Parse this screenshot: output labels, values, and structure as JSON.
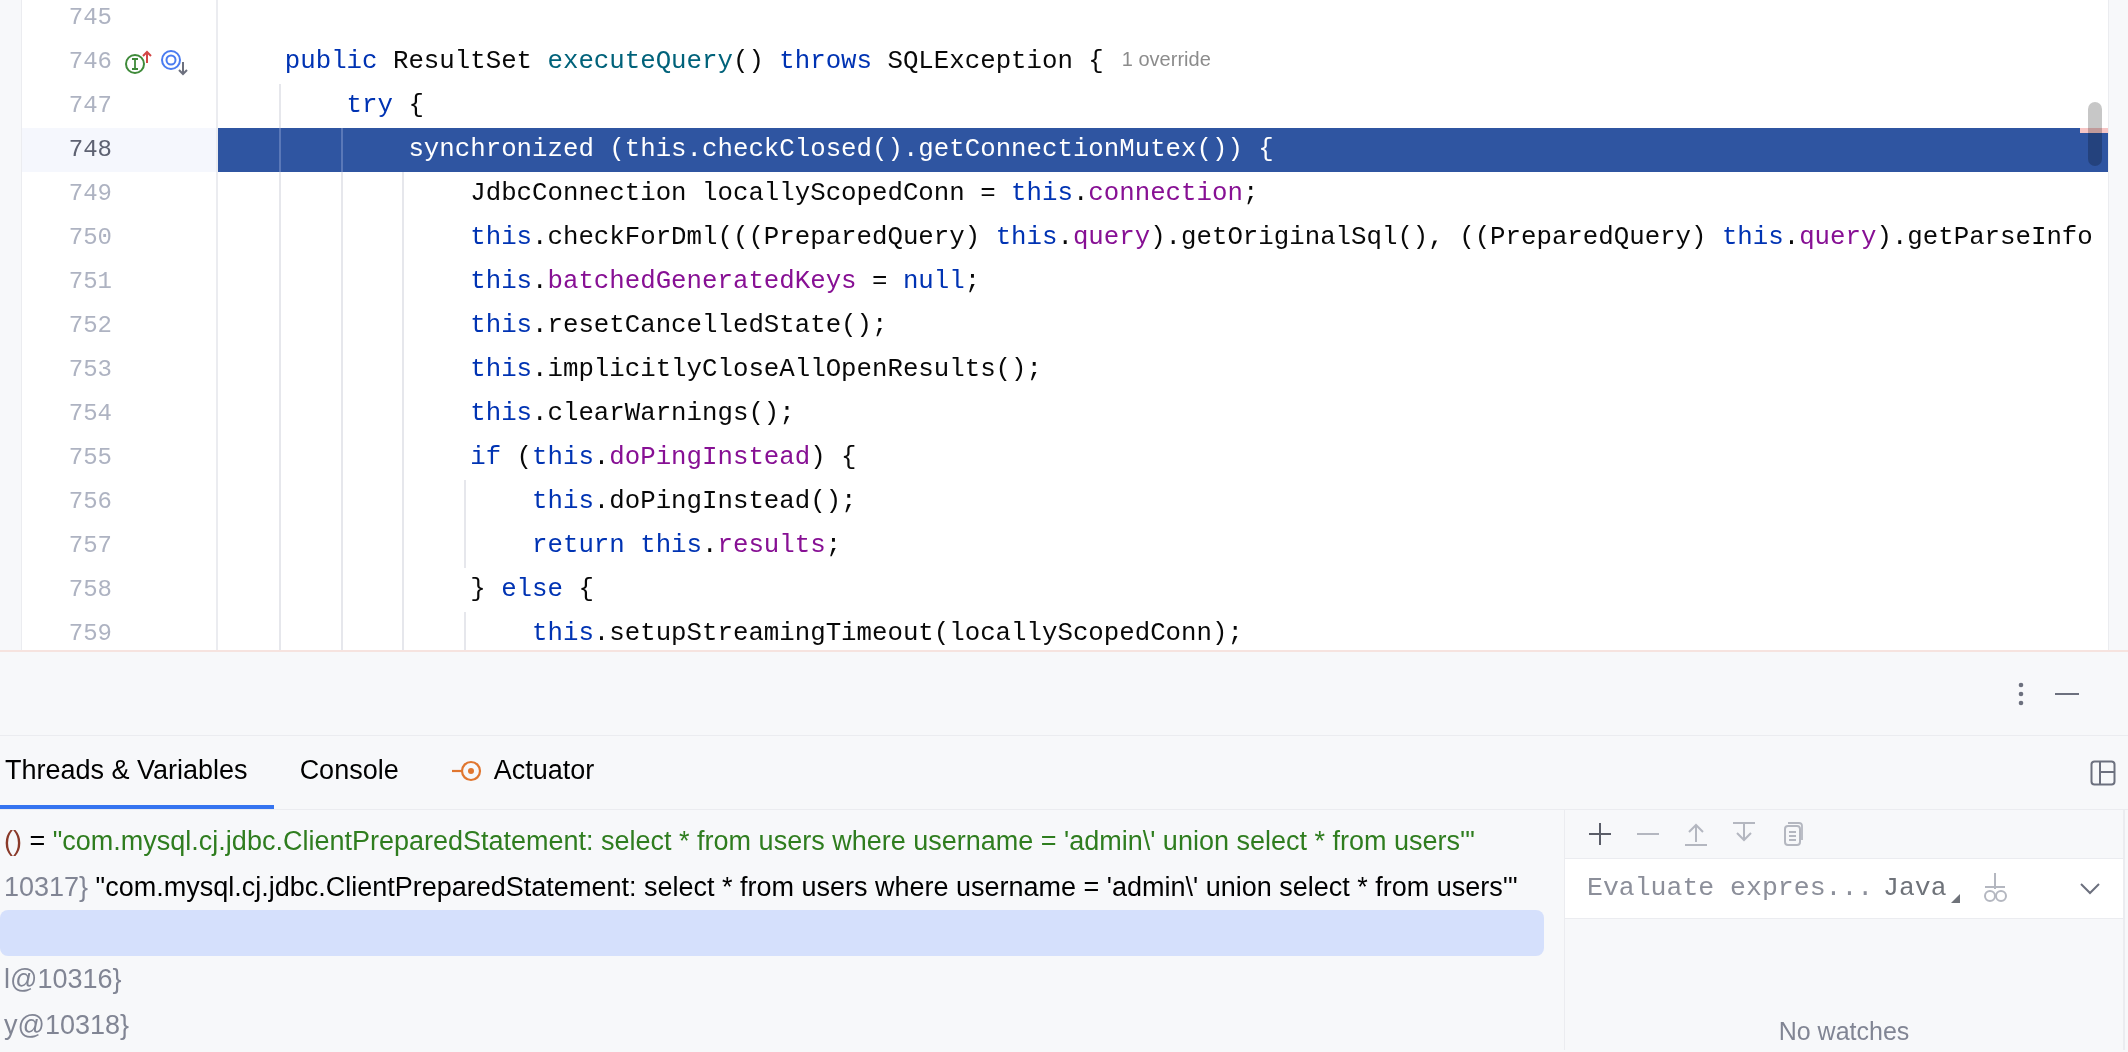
{
  "editor": {
    "lines": [
      {
        "number": "745",
        "current": false,
        "gutter_marks": false
      },
      {
        "number": "746",
        "current": false,
        "gutter_marks": true,
        "tokens": [
          {
            "t": "    public",
            "kind": "keyword"
          },
          {
            "t": " ResultSet ",
            "kind": "plain"
          },
          {
            "t": "executeQuery",
            "kind": "method"
          },
          {
            "t": "() ",
            "kind": "plain"
          },
          {
            "t": "throws",
            "kind": "keyword"
          },
          {
            "t": " SQLException {",
            "kind": "plain"
          }
        ],
        "hint": "1 override"
      },
      {
        "number": "747",
        "current": false,
        "gutter_marks": false,
        "tokens": [
          {
            "t": "        try",
            "kind": "keyword"
          },
          {
            "t": " {",
            "kind": "plain"
          }
        ]
      },
      {
        "number": "748",
        "current": true,
        "gutter_marks": false,
        "tokens": [
          {
            "t": "            synchronized",
            "kind": "keyword"
          },
          {
            "t": " (",
            "kind": "plain"
          },
          {
            "t": "this",
            "kind": "keyword"
          },
          {
            "t": ".checkClosed().getConnectionMutex()) {",
            "kind": "plain"
          }
        ]
      },
      {
        "number": "749",
        "current": false,
        "gutter_marks": false,
        "tokens": [
          {
            "t": "                JdbcConnection locallyScopedConn = ",
            "kind": "plain"
          },
          {
            "t": "this",
            "kind": "keyword"
          },
          {
            "t": ".",
            "kind": "plain"
          },
          {
            "t": "connection",
            "kind": "field"
          },
          {
            "t": ";",
            "kind": "plain"
          }
        ]
      },
      {
        "number": "750",
        "current": false,
        "gutter_marks": false,
        "tokens": [
          {
            "t": "                this",
            "kind": "keyword"
          },
          {
            "t": ".checkForDml(((PreparedQuery) ",
            "kind": "plain"
          },
          {
            "t": "this",
            "kind": "keyword"
          },
          {
            "t": ".",
            "kind": "plain"
          },
          {
            "t": "query",
            "kind": "field"
          },
          {
            "t": ").getOriginalSql(), ((PreparedQuery) ",
            "kind": "plain"
          },
          {
            "t": "this",
            "kind": "keyword"
          },
          {
            "t": ".",
            "kind": "plain"
          },
          {
            "t": "query",
            "kind": "field"
          },
          {
            "t": ").getParseInfo",
            "kind": "plain"
          }
        ]
      },
      {
        "number": "751",
        "current": false,
        "gutter_marks": false,
        "tokens": [
          {
            "t": "                this",
            "kind": "keyword"
          },
          {
            "t": ".",
            "kind": "plain"
          },
          {
            "t": "batchedGeneratedKeys",
            "kind": "field"
          },
          {
            "t": " = ",
            "kind": "plain"
          },
          {
            "t": "null",
            "kind": "keyword"
          },
          {
            "t": ";",
            "kind": "plain"
          }
        ]
      },
      {
        "number": "752",
        "current": false,
        "gutter_marks": false,
        "tokens": [
          {
            "t": "                this",
            "kind": "keyword"
          },
          {
            "t": ".resetCancelledState();",
            "kind": "plain"
          }
        ]
      },
      {
        "number": "753",
        "current": false,
        "gutter_marks": false,
        "tokens": [
          {
            "t": "                this",
            "kind": "keyword"
          },
          {
            "t": ".implicitlyCloseAllOpenResults();",
            "kind": "plain"
          }
        ]
      },
      {
        "number": "754",
        "current": false,
        "gutter_marks": false,
        "tokens": [
          {
            "t": "                this",
            "kind": "keyword"
          },
          {
            "t": ".clearWarnings();",
            "kind": "plain"
          }
        ]
      },
      {
        "number": "755",
        "current": false,
        "gutter_marks": false,
        "tokens": [
          {
            "t": "                if",
            "kind": "keyword"
          },
          {
            "t": " (",
            "kind": "plain"
          },
          {
            "t": "this",
            "kind": "keyword"
          },
          {
            "t": ".",
            "kind": "plain"
          },
          {
            "t": "doPingInstead",
            "kind": "field"
          },
          {
            "t": ") {",
            "kind": "plain"
          }
        ]
      },
      {
        "number": "756",
        "current": false,
        "gutter_marks": false,
        "tokens": [
          {
            "t": "                    this",
            "kind": "keyword"
          },
          {
            "t": ".doPingInstead();",
            "kind": "plain"
          }
        ]
      },
      {
        "number": "757",
        "current": false,
        "gutter_marks": false,
        "tokens": [
          {
            "t": "                    return ",
            "kind": "keyword"
          },
          {
            "t": "this",
            "kind": "keyword"
          },
          {
            "t": ".",
            "kind": "plain"
          },
          {
            "t": "results",
            "kind": "field"
          },
          {
            "t": ";",
            "kind": "plain"
          }
        ]
      },
      {
        "number": "758",
        "current": false,
        "gutter_marks": false,
        "tokens": [
          {
            "t": "                } ",
            "kind": "plain"
          },
          {
            "t": "else",
            "kind": "keyword"
          },
          {
            "t": " {",
            "kind": "plain"
          }
        ]
      },
      {
        "number": "759",
        "current": false,
        "gutter_marks": false,
        "tokens": [
          {
            "t": "                    this",
            "kind": "keyword"
          },
          {
            "t": ".setupStreamingTimeout(locallyScopedConn);",
            "kind": "plain"
          }
        ]
      }
    ]
  },
  "debug_panel": {
    "tabs": [
      {
        "label": "Threads & Variables",
        "selected": true,
        "kind": "text"
      },
      {
        "label": "Console",
        "selected": false,
        "kind": "text"
      },
      {
        "label": "Actuator",
        "selected": false,
        "kind": "icon_text"
      }
    ],
    "variables": [
      {
        "selected": false,
        "segments": [
          {
            "t": "()",
            "kind": "call"
          },
          {
            "t": " = ",
            "kind": "plain"
          },
          {
            "t": "\"com.mysql.cj.jdbc.ClientPreparedStatement: select * from users where username = 'admin\\' union select * from users'\"",
            "kind": "string"
          }
        ]
      },
      {
        "selected": false,
        "segments": [
          {
            "t": "10317}",
            "kind": "id"
          },
          {
            "t": " \"com.mysql.cj.jdbc.ClientPreparedStatement: select * from users where username = 'admin\\' union select * from users'\"",
            "kind": "plain"
          }
        ]
      },
      {
        "selected": true
      },
      {
        "selected": false,
        "segments": [
          {
            "t": "l@10316}",
            "kind": "id"
          }
        ]
      },
      {
        "selected": false,
        "segments": [
          {
            "t": "y@10318}",
            "kind": "id"
          }
        ]
      }
    ],
    "watch_toolbar": [
      {
        "kind": "add",
        "disabled": false
      },
      {
        "kind": "remove",
        "disabled": true
      },
      {
        "kind": "move_up",
        "disabled": true
      },
      {
        "kind": "move_down",
        "disabled": true
      },
      {
        "kind": "copy",
        "disabled": true
      }
    ],
    "watches": {
      "placeholder": "Evaluate expres...",
      "language": "Java",
      "empty_text": "No watches"
    }
  }
}
